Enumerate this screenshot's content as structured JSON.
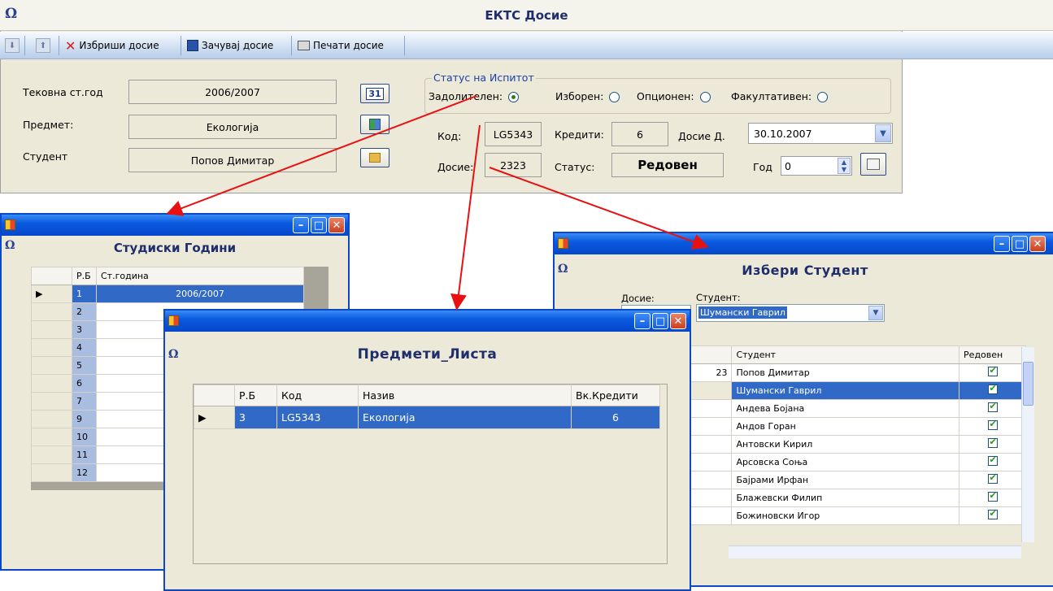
{
  "main": {
    "title": "ЕКТС Досие",
    "toolbar": {
      "delete_label": "Избриши досие",
      "save_label": "Зачувај досие",
      "print_label": "Печати досие"
    },
    "fields": {
      "year_label": "Тековна ст.год",
      "year_value": "2006/2007",
      "subject_label": "Предмет:",
      "subject_value": "Екологија",
      "student_label": "Студент",
      "student_value": "Попов Димитар"
    },
    "status_group": {
      "legend": "Статус на Испитот",
      "mandatory": "Задолителен:",
      "chosen": "Изборен:",
      "optional": "Опционен:",
      "facultative": "Факултативен:"
    },
    "code_label": "Код:",
    "code_value": "LG5343",
    "credits_label": "Кредити:",
    "credits_value": "6",
    "dossier_date_label": "Досие Д.",
    "dossier_date_value": "30.10.2007",
    "dossier_label": "Досие:",
    "dossier_value": "2323",
    "status_label": "Статус:",
    "status_value": "Редовен",
    "year2_label": "Год",
    "year2_value": "0"
  },
  "years_window": {
    "title": "Студиски Години",
    "columns": [
      "Р.Б",
      "Ст.година"
    ],
    "rows": [
      {
        "rb": "1",
        "year": "2006/2007"
      },
      {
        "rb": "2",
        "year": ""
      },
      {
        "rb": "3",
        "year": ""
      },
      {
        "rb": "4",
        "year": ""
      },
      {
        "rb": "5",
        "year": ""
      },
      {
        "rb": "6",
        "year": ""
      },
      {
        "rb": "7",
        "year": ""
      },
      {
        "rb": "9",
        "year": ""
      },
      {
        "rb": "10",
        "year": ""
      },
      {
        "rb": "11",
        "year": ""
      },
      {
        "rb": "12",
        "year": ""
      }
    ]
  },
  "subjects_window": {
    "title": "Предмети_Листа",
    "columns": [
      "Р.Б",
      "Код",
      "Назив",
      "Вк.Кредити"
    ],
    "row": {
      "rb": "3",
      "code": "LG5343",
      "name": "Екологија",
      "credits": "6"
    }
  },
  "student_window": {
    "title": "Избери  Студент",
    "dossier_label": "Досие:",
    "student_label": "Студент:",
    "student_value": "Шумански Гаврил",
    "columns": [
      "Студент",
      "Редовен"
    ],
    "rows": [
      {
        "partial": "23",
        "name": "Попов Димитар",
        "regular": true
      },
      {
        "partial": "",
        "name": "Шумански Гаврил",
        "regular": true
      },
      {
        "partial": "",
        "name": "Андева Бојана",
        "regular": true
      },
      {
        "partial": "",
        "name": "Андов Горан",
        "regular": true
      },
      {
        "partial": "",
        "name": "Антовски Кирил",
        "regular": true
      },
      {
        "partial": "",
        "name": "Арсовска Соња",
        "regular": true
      },
      {
        "partial": "",
        "name": "Бајрами Ирфан",
        "regular": true
      },
      {
        "partial": "",
        "name": "Блажевски Филип",
        "regular": true
      },
      {
        "partial": "",
        "name": "Божиновски Игор",
        "regular": true
      }
    ]
  },
  "colors": {
    "selection": "#3169c6",
    "arrow": "#e81010",
    "xp_title": "#0a5ae0"
  }
}
